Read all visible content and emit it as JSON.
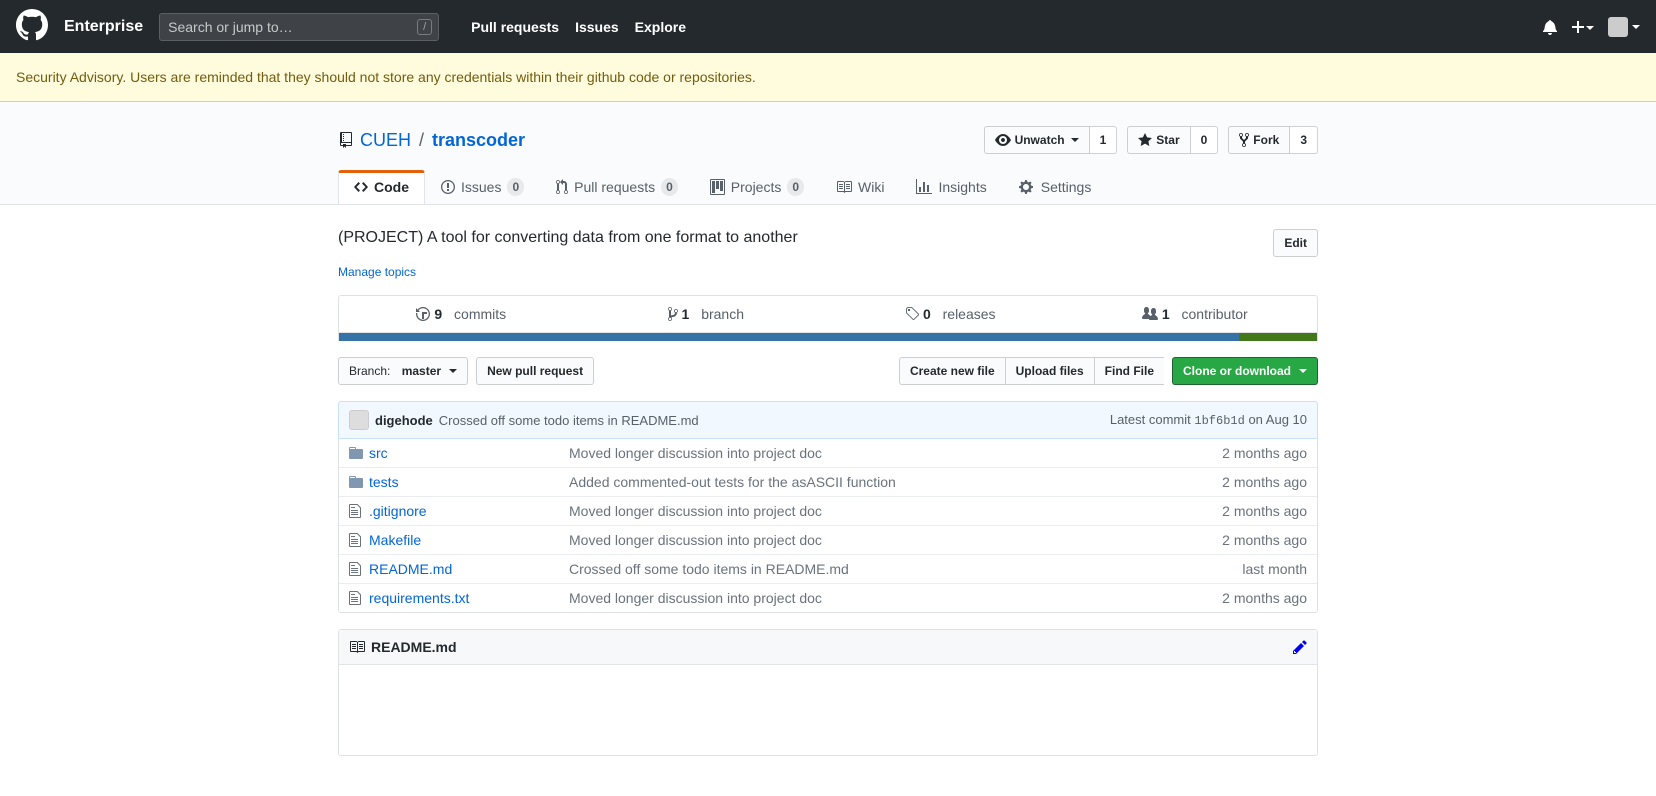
{
  "header": {
    "enterprise": "Enterprise",
    "search_placeholder": "Search or jump to…",
    "nav": [
      "Pull requests",
      "Issues",
      "Explore"
    ]
  },
  "flash": "Security Advisory. Users are reminded that they should not store any credentials within their github code or repositories.",
  "repo": {
    "owner": "CUEH",
    "name": "transcoder"
  },
  "actions": {
    "unwatch": {
      "label": "Unwatch",
      "count": "1"
    },
    "star": {
      "label": "Star",
      "count": "0"
    },
    "fork": {
      "label": "Fork",
      "count": "3"
    }
  },
  "tabs": {
    "code": "Code",
    "issues": {
      "label": "Issues",
      "count": "0"
    },
    "pulls": {
      "label": "Pull requests",
      "count": "0"
    },
    "projects": {
      "label": "Projects",
      "count": "0"
    },
    "wiki": "Wiki",
    "insights": "Insights",
    "settings": "Settings"
  },
  "description": "(PROJECT) A tool for converting data from one format to another",
  "edit_label": "Edit",
  "manage_topics": "Manage topics",
  "summary": {
    "commits": {
      "count": "9",
      "label": "commits"
    },
    "branches": {
      "count": "1",
      "label": "branch"
    },
    "releases": {
      "count": "0",
      "label": "releases"
    },
    "contributors": {
      "count": "1",
      "label": "contributor"
    }
  },
  "branch_selector": {
    "prefix": "Branch:",
    "value": "master"
  },
  "new_pr": "New pull request",
  "file_actions": {
    "create": "Create new file",
    "upload": "Upload files",
    "find": "Find File",
    "clone": "Clone or download"
  },
  "commit_tease": {
    "author": "digehode",
    "message": "Crossed off some todo items in README.md",
    "latest": "Latest commit",
    "sha": "1bf6b1d",
    "date": "on Aug 10"
  },
  "files": [
    {
      "type": "dir",
      "name": "src",
      "msg": "Moved longer discussion into project doc",
      "age": "2 months ago"
    },
    {
      "type": "dir",
      "name": "tests",
      "msg": "Added commented-out tests for the asASCII function",
      "age": "2 months ago"
    },
    {
      "type": "file",
      "name": ".gitignore",
      "msg": "Moved longer discussion into project doc",
      "age": "2 months ago"
    },
    {
      "type": "file",
      "name": "Makefile",
      "msg": "Moved longer discussion into project doc",
      "age": "2 months ago"
    },
    {
      "type": "file",
      "name": "README.md",
      "msg": "Crossed off some todo items in README.md",
      "age": "last month"
    },
    {
      "type": "file",
      "name": "requirements.txt",
      "msg": "Moved longer discussion into project doc",
      "age": "2 months ago"
    }
  ],
  "readme": {
    "filename": "README.md"
  }
}
